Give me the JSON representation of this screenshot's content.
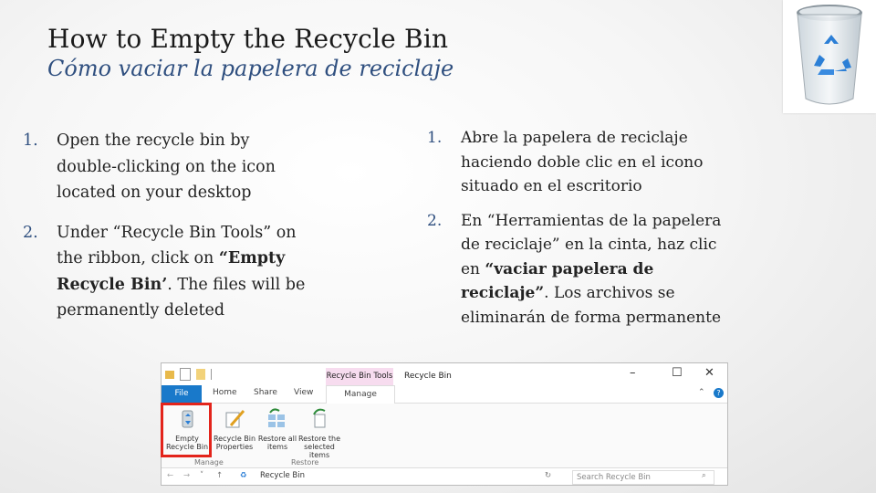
{
  "slide": {
    "title_en": "How to Empty the Recycle Bin",
    "title_es": "Cómo vaciar la papelera de reciclaje"
  },
  "steps_en": [
    {
      "num": "1.",
      "text": "Open the recycle bin by double-clicking on the icon located on your desktop"
    },
    {
      "num": "2.",
      "text_pre": "Under “Recycle Bin Tools” on the ribbon, click on ",
      "text_bold": "“Empty Recycle Bin’",
      "text_post": ". The files will be permanently deleted"
    }
  ],
  "steps_es": [
    {
      "num": "1.",
      "text": "Abre la papelera de reciclaje haciendo doble clic en el icono situado en el escritorio"
    },
    {
      "num": "2.",
      "text_pre": "En “Herramientas de la papelera de reciclaje” en la cinta, haz clic en ",
      "text_bold": "“vaciar papelera de reciclaje”",
      "text_post": ". Los archivos se eliminarán de forma permanente"
    }
  ],
  "explorer": {
    "context_tab": "Recycle Bin Tools",
    "window_title": "Recycle Bin",
    "tabs": [
      "File",
      "Home",
      "Share",
      "View",
      "Manage"
    ],
    "ribbon": {
      "empty_recycle_bin": "Empty Recycle Bin",
      "recycle_bin_properties": "Recycle Bin Properties",
      "restore_all": "Restore all items",
      "restore_selected": "Restore the selected items",
      "group_manage": "Manage",
      "group_restore": "Restore"
    },
    "address": "Recycle Bin",
    "search_placeholder": "Search Recycle Bin",
    "accent": "#1979ca",
    "highlight_color": "#e3241b"
  }
}
